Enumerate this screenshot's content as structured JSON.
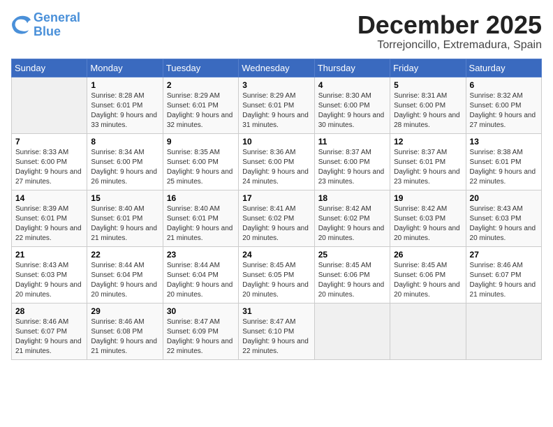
{
  "logo": {
    "line1": "General",
    "line2": "Blue"
  },
  "title": "December 2025",
  "location": "Torrejoncillo, Extremadura, Spain",
  "days_of_week": [
    "Sunday",
    "Monday",
    "Tuesday",
    "Wednesday",
    "Thursday",
    "Friday",
    "Saturday"
  ],
  "weeks": [
    [
      null,
      {
        "day": "1",
        "sunrise": "8:28 AM",
        "sunset": "6:01 PM",
        "daylight": "9 hours and 33 minutes."
      },
      {
        "day": "2",
        "sunrise": "8:29 AM",
        "sunset": "6:01 PM",
        "daylight": "9 hours and 32 minutes."
      },
      {
        "day": "3",
        "sunrise": "8:29 AM",
        "sunset": "6:01 PM",
        "daylight": "9 hours and 31 minutes."
      },
      {
        "day": "4",
        "sunrise": "8:30 AM",
        "sunset": "6:00 PM",
        "daylight": "9 hours and 30 minutes."
      },
      {
        "day": "5",
        "sunrise": "8:31 AM",
        "sunset": "6:00 PM",
        "daylight": "9 hours and 28 minutes."
      },
      {
        "day": "6",
        "sunrise": "8:32 AM",
        "sunset": "6:00 PM",
        "daylight": "9 hours and 27 minutes."
      }
    ],
    [
      {
        "day": "7",
        "sunrise": "8:33 AM",
        "sunset": "6:00 PM",
        "daylight": "9 hours and 27 minutes."
      },
      {
        "day": "8",
        "sunrise": "8:34 AM",
        "sunset": "6:00 PM",
        "daylight": "9 hours and 26 minutes."
      },
      {
        "day": "9",
        "sunrise": "8:35 AM",
        "sunset": "6:00 PM",
        "daylight": "9 hours and 25 minutes."
      },
      {
        "day": "10",
        "sunrise": "8:36 AM",
        "sunset": "6:00 PM",
        "daylight": "9 hours and 24 minutes."
      },
      {
        "day": "11",
        "sunrise": "8:37 AM",
        "sunset": "6:00 PM",
        "daylight": "9 hours and 23 minutes."
      },
      {
        "day": "12",
        "sunrise": "8:37 AM",
        "sunset": "6:01 PM",
        "daylight": "9 hours and 23 minutes."
      },
      {
        "day": "13",
        "sunrise": "8:38 AM",
        "sunset": "6:01 PM",
        "daylight": "9 hours and 22 minutes."
      }
    ],
    [
      {
        "day": "14",
        "sunrise": "8:39 AM",
        "sunset": "6:01 PM",
        "daylight": "9 hours and 22 minutes."
      },
      {
        "day": "15",
        "sunrise": "8:40 AM",
        "sunset": "6:01 PM",
        "daylight": "9 hours and 21 minutes."
      },
      {
        "day": "16",
        "sunrise": "8:40 AM",
        "sunset": "6:01 PM",
        "daylight": "9 hours and 21 minutes."
      },
      {
        "day": "17",
        "sunrise": "8:41 AM",
        "sunset": "6:02 PM",
        "daylight": "9 hours and 20 minutes."
      },
      {
        "day": "18",
        "sunrise": "8:42 AM",
        "sunset": "6:02 PM",
        "daylight": "9 hours and 20 minutes."
      },
      {
        "day": "19",
        "sunrise": "8:42 AM",
        "sunset": "6:03 PM",
        "daylight": "9 hours and 20 minutes."
      },
      {
        "day": "20",
        "sunrise": "8:43 AM",
        "sunset": "6:03 PM",
        "daylight": "9 hours and 20 minutes."
      }
    ],
    [
      {
        "day": "21",
        "sunrise": "8:43 AM",
        "sunset": "6:03 PM",
        "daylight": "9 hours and 20 minutes."
      },
      {
        "day": "22",
        "sunrise": "8:44 AM",
        "sunset": "6:04 PM",
        "daylight": "9 hours and 20 minutes."
      },
      {
        "day": "23",
        "sunrise": "8:44 AM",
        "sunset": "6:04 PM",
        "daylight": "9 hours and 20 minutes."
      },
      {
        "day": "24",
        "sunrise": "8:45 AM",
        "sunset": "6:05 PM",
        "daylight": "9 hours and 20 minutes."
      },
      {
        "day": "25",
        "sunrise": "8:45 AM",
        "sunset": "6:06 PM",
        "daylight": "9 hours and 20 minutes."
      },
      {
        "day": "26",
        "sunrise": "8:45 AM",
        "sunset": "6:06 PM",
        "daylight": "9 hours and 20 minutes."
      },
      {
        "day": "27",
        "sunrise": "8:46 AM",
        "sunset": "6:07 PM",
        "daylight": "9 hours and 21 minutes."
      }
    ],
    [
      {
        "day": "28",
        "sunrise": "8:46 AM",
        "sunset": "6:07 PM",
        "daylight": "9 hours and 21 minutes."
      },
      {
        "day": "29",
        "sunrise": "8:46 AM",
        "sunset": "6:08 PM",
        "daylight": "9 hours and 21 minutes."
      },
      {
        "day": "30",
        "sunrise": "8:47 AM",
        "sunset": "6:09 PM",
        "daylight": "9 hours and 22 minutes."
      },
      {
        "day": "31",
        "sunrise": "8:47 AM",
        "sunset": "6:10 PM",
        "daylight": "9 hours and 22 minutes."
      },
      null,
      null,
      null
    ]
  ]
}
